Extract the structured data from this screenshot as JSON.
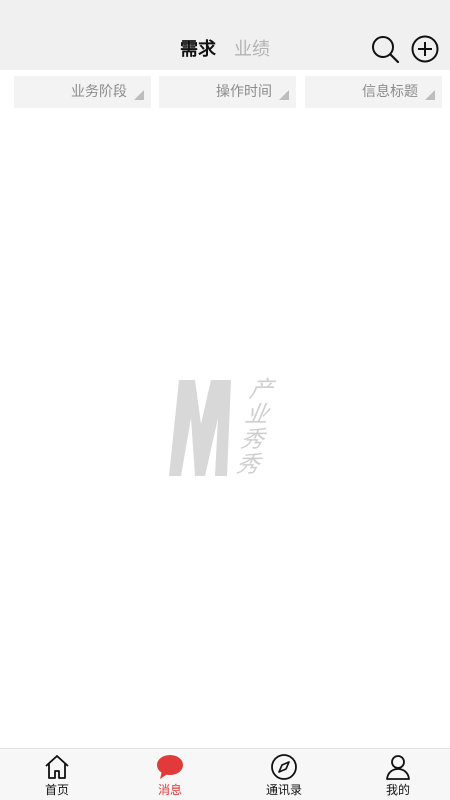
{
  "header": {
    "tabs": [
      {
        "label": "需求",
        "active": true
      },
      {
        "label": "业绩",
        "active": false
      }
    ],
    "icons": [
      "search-icon",
      "add-circle-icon"
    ]
  },
  "filters": [
    {
      "label": "业务阶段"
    },
    {
      "label": "操作时间"
    },
    {
      "label": "信息标题"
    }
  ],
  "watermark": {
    "letter": "M",
    "lines": [
      "产",
      "业",
      "秀",
      "秀"
    ]
  },
  "tabbar": {
    "items": [
      {
        "label": "首页",
        "icon": "home-icon",
        "active": false
      },
      {
        "label": "消息",
        "icon": "message-icon",
        "active": true
      },
      {
        "label": "通讯录",
        "icon": "compass-icon",
        "active": false
      },
      {
        "label": "我的",
        "icon": "user-icon",
        "active": false
      }
    ],
    "active_color": "#e03a3a"
  }
}
